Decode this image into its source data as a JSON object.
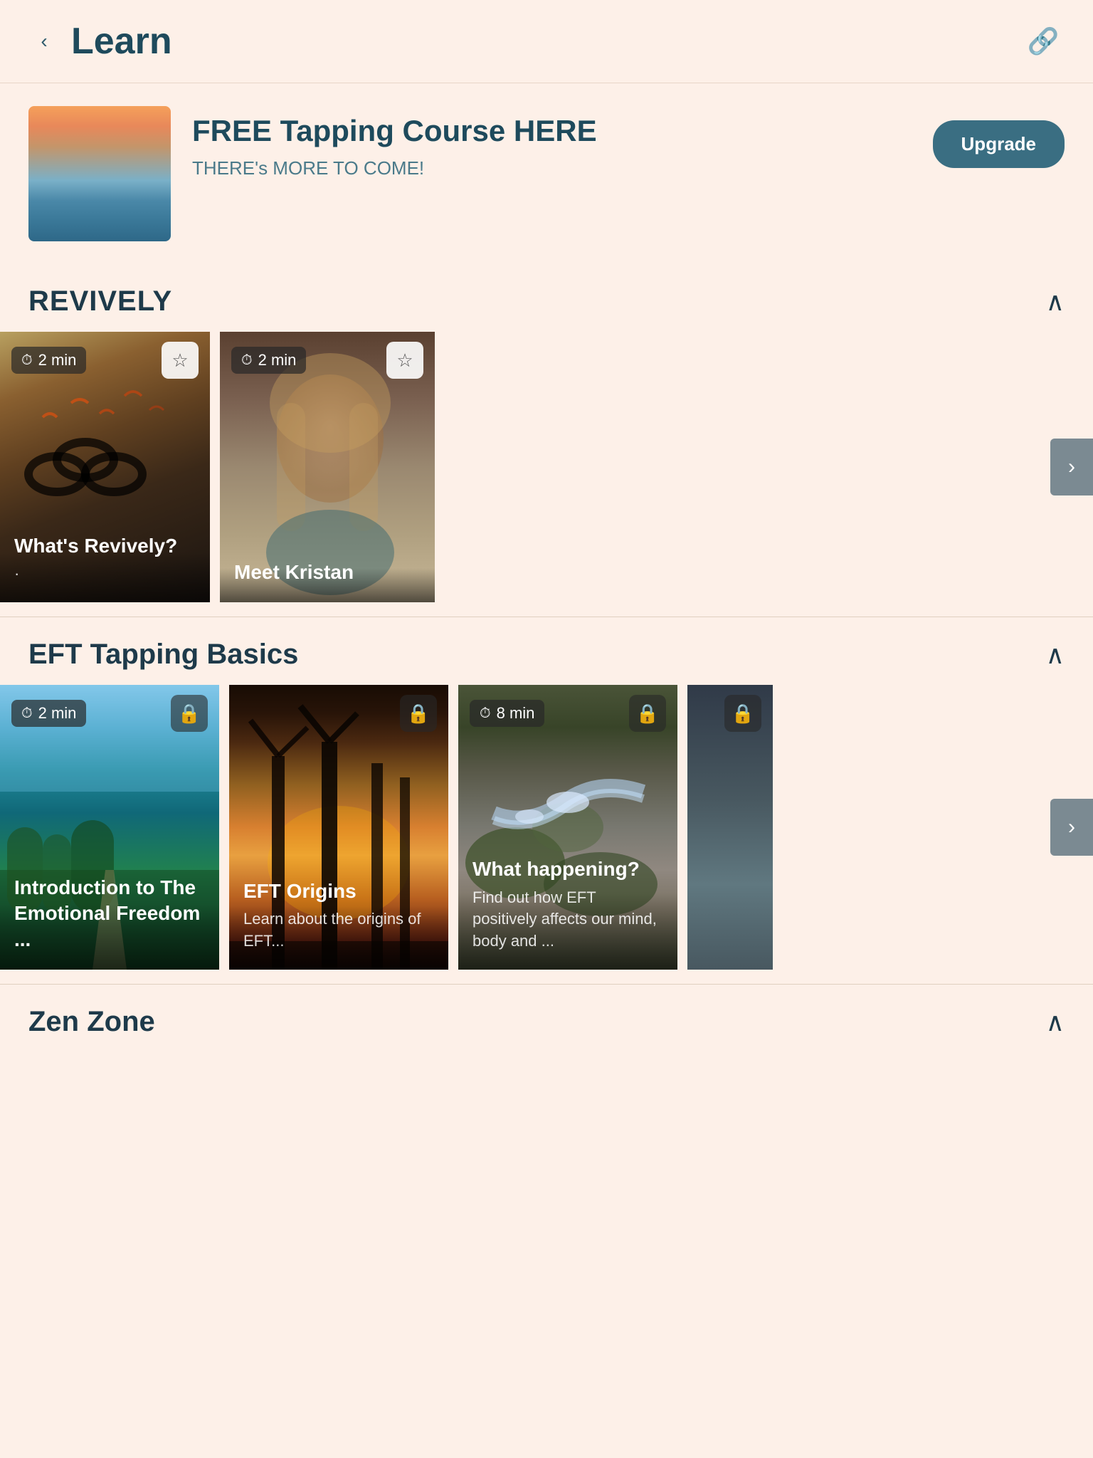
{
  "header": {
    "back_label": "Learn",
    "share_icon": "🔗"
  },
  "hero": {
    "title": "FREE Tapping Course HERE",
    "subtitle": "THERE's MORE TO COME!",
    "upgrade_label": "Upgrade"
  },
  "sections": [
    {
      "id": "revively",
      "title": "REVIVELY",
      "cards": [
        {
          "title": "What's Revively?",
          "desc": "",
          "duration": "2 min",
          "action": "star",
          "bg": "revively-1"
        },
        {
          "title": "Meet Kristan",
          "desc": "",
          "duration": "2 min",
          "action": "star",
          "bg": "revively-2"
        }
      ]
    },
    {
      "id": "eft",
      "title": "EFT Tapping Basics",
      "cards": [
        {
          "title": "Introduction to The Emotional Freedom ...",
          "desc": "",
          "duration": "2 min",
          "action": "lock",
          "bg": "eft-1"
        },
        {
          "title": "EFT Origins",
          "desc": "Learn about the origins of EFT...",
          "duration": "",
          "action": "lock",
          "bg": "eft-2"
        },
        {
          "title": "What happening?",
          "desc": "Find out how EFT positively affects our mind, body and ...",
          "duration": "8 min",
          "action": "lock",
          "bg": "eft-3"
        },
        {
          "title": "",
          "desc": "",
          "duration": "",
          "action": "lock",
          "bg": "eft-4"
        }
      ]
    },
    {
      "id": "zen",
      "title": "Zen Zone",
      "cards": []
    }
  ],
  "icons": {
    "clock": "🕐",
    "star": "☆",
    "lock": "🔒",
    "chevron_up": "∧",
    "chevron_right": "›",
    "back": "‹"
  }
}
